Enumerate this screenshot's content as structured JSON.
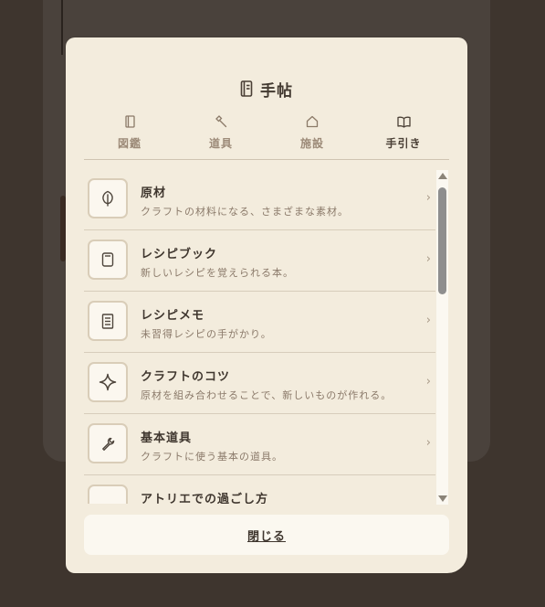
{
  "modal": {
    "title": "手帖",
    "title_icon": "notebook-icon",
    "close_label": "閉じる"
  },
  "tabs": [
    {
      "label": "図鑑",
      "icon": "book-icon",
      "active": false
    },
    {
      "label": "道具",
      "icon": "hammer-icon",
      "active": false
    },
    {
      "label": "施設",
      "icon": "house-icon",
      "active": false
    },
    {
      "label": "手引き",
      "icon": "open-book-icon",
      "active": true
    }
  ],
  "items": [
    {
      "title": "原材",
      "desc": "クラフトの材料になる、さまざまな素材。",
      "icon": "leaf-icon"
    },
    {
      "title": "レシピブック",
      "desc": "新しいレシピを覚えられる本。",
      "icon": "recipe-book-icon"
    },
    {
      "title": "レシピメモ",
      "desc": "未習得レシピの手がかり。",
      "icon": "memo-icon"
    },
    {
      "title": "クラフトのコツ",
      "desc": "原材を組み合わせることで、新しいものが作れる。",
      "icon": "sparkle-icon"
    },
    {
      "title": "基本道具",
      "desc": "クラフトに使う基本の道具。",
      "icon": "wrench-icon"
    },
    {
      "title": "アトリエでの過ごし方",
      "desc": "",
      "icon": "atelier-icon"
    }
  ],
  "chevron": "›",
  "colors": {
    "background": "#3e352e",
    "modal": "#f3ecdd",
    "text": "#3f362e",
    "muted": "#8b7a6a"
  }
}
